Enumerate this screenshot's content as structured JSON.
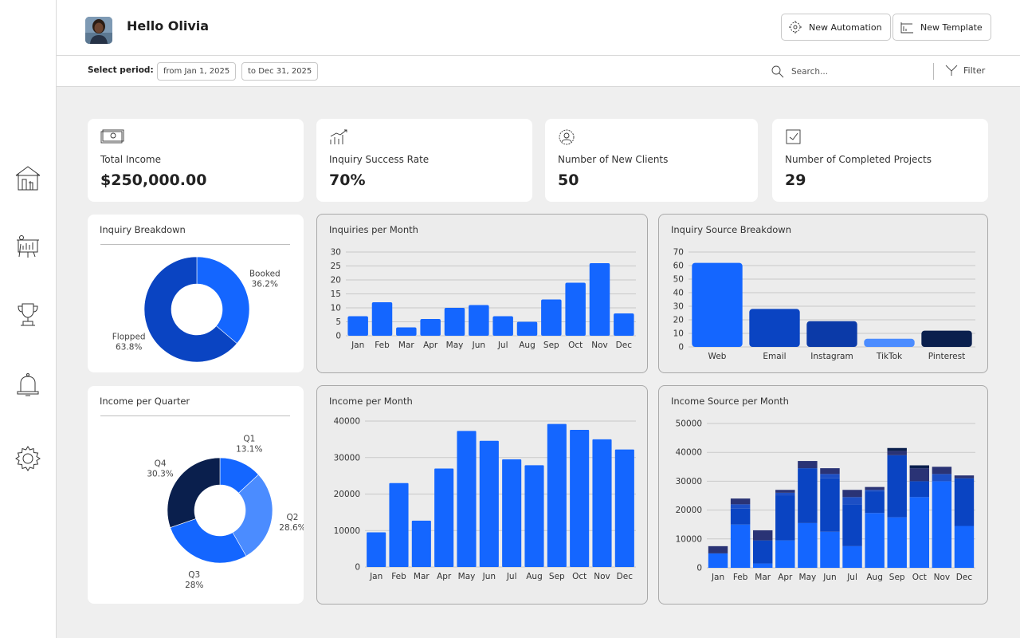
{
  "user": {
    "greeting": "Hello Olivia"
  },
  "header": {
    "new_automation_label": "New Automation",
    "new_template_label": "New Template"
  },
  "period": {
    "label": "Select period:",
    "from": "from Jan 1, 2025",
    "to": "to Dec 31, 2025"
  },
  "search": {
    "placeholder": "Search..."
  },
  "filter": {
    "label": "Filter"
  },
  "sidebar": {
    "items": [
      "home-icon",
      "presentation-icon",
      "trophy-icon",
      "bell-icon",
      "gear-icon"
    ]
  },
  "stats": [
    {
      "label": "Total Income",
      "value": "$250,000.00",
      "icon": "cash-icon"
    },
    {
      "label": "Inquiry Success Rate",
      "value": "70%",
      "icon": "growth-chart-icon"
    },
    {
      "label": "Number of New Clients",
      "value": "50",
      "icon": "clients-icon"
    },
    {
      "label": "Number of Completed Projects",
      "value": "29",
      "icon": "completed-projects-icon"
    }
  ],
  "colors": {
    "primary": "#1466ff",
    "blue2": "#0a44c2",
    "blue3": "#0b3aa8",
    "light_blue": "#4b8cff",
    "navy": "#0a1f4d",
    "purple_navy": "#2a3375"
  },
  "chart_data": [
    {
      "type": "pie",
      "title": "Inquiry Breakdown",
      "donut": true,
      "slices": [
        {
          "label": "Booked",
          "value": 36.2,
          "display": "36.2%",
          "color": "#1466ff"
        },
        {
          "label": "Flopped",
          "value": 63.8,
          "display": "63.8%",
          "color": "#0a44c2"
        }
      ]
    },
    {
      "type": "bar",
      "title": "Inquiries per Month",
      "categories": [
        "Jan",
        "Feb",
        "Mar",
        "Apr",
        "May",
        "Jun",
        "Jul",
        "Aug",
        "Sep",
        "Oct",
        "Nov",
        "Dec"
      ],
      "values": [
        7,
        12,
        3,
        6,
        10,
        11,
        7,
        5,
        13,
        19,
        26,
        8
      ],
      "ylim": [
        0,
        30
      ],
      "yticks": [
        0,
        5,
        10,
        15,
        20,
        25,
        30
      ],
      "grid": true,
      "color": "#1466ff"
    },
    {
      "type": "bar",
      "title": "Inquiry Source Breakdown",
      "categories": [
        "Web",
        "Email",
        "Instagram",
        "TikTok",
        "Pinterest"
      ],
      "values": [
        62,
        28,
        19,
        6,
        12
      ],
      "colors": [
        "#1466ff",
        "#0a44c2",
        "#0b3aa8",
        "#4b8cff",
        "#0a1f4d"
      ],
      "ylim": [
        0,
        70
      ],
      "yticks": [
        0,
        10,
        20,
        30,
        40,
        50,
        60,
        70
      ],
      "grid": true
    },
    {
      "type": "pie",
      "title": "Income per Quarter",
      "donut": true,
      "slices": [
        {
          "label": "Q1",
          "value": 13.1,
          "display": "13.1%",
          "color": "#1466ff"
        },
        {
          "label": "Q2",
          "value": 28.6,
          "display": "28.6%",
          "color": "#4b8cff"
        },
        {
          "label": "Q3",
          "value": 28.0,
          "display": "28%",
          "color": "#1466ff"
        },
        {
          "label": "Q4",
          "value": 30.3,
          "display": "30.3%",
          "color": "#0a1f4d"
        }
      ]
    },
    {
      "type": "bar",
      "title": "Income per Month",
      "categories": [
        "Jan",
        "Feb",
        "Mar",
        "Apr",
        "May",
        "Jun",
        "Jul",
        "Aug",
        "Sep",
        "Oct",
        "Nov",
        "Dec"
      ],
      "values": [
        9500,
        23000,
        12700,
        27000,
        37300,
        34600,
        29500,
        27900,
        39200,
        37600,
        35000,
        32200
      ],
      "ylim": [
        0,
        40000
      ],
      "yticks": [
        0,
        10000,
        20000,
        30000,
        40000
      ],
      "grid": true,
      "color": "#1466ff"
    },
    {
      "type": "bar",
      "stacked": true,
      "title": "Income Source per Month",
      "categories": [
        "Jan",
        "Feb",
        "Mar",
        "Apr",
        "May",
        "Jun",
        "Jul",
        "Aug",
        "Sep",
        "Oct",
        "Nov",
        "Dec"
      ],
      "ylim": [
        0,
        50000
      ],
      "yticks": [
        0,
        10000,
        20000,
        30000,
        40000,
        50000
      ],
      "grid": true,
      "series": [
        {
          "values": [
            5000,
            15000,
            1500,
            9500,
            15500,
            12500,
            7500,
            19000,
            17500,
            24500,
            30000,
            14500
          ],
          "color": "#1466ff"
        },
        {
          "values": [
            0,
            5500,
            8000,
            15500,
            19000,
            18500,
            14500,
            7500,
            21500,
            5500,
            0,
            16500
          ],
          "color": "#0a44c2"
        },
        {
          "values": [
            0,
            1500,
            0,
            1000,
            0,
            1500,
            2500,
            500,
            0,
            0,
            2500,
            0
          ],
          "color": "#1d4fc4"
        },
        {
          "values": [
            2500,
            2000,
            3500,
            1000,
            2500,
            2000,
            2500,
            1000,
            1500,
            4500,
            2500,
            1000
          ],
          "color": "#2a3375"
        },
        {
          "values": [
            0,
            0,
            0,
            0,
            0,
            0,
            0,
            0,
            1000,
            1000,
            0,
            0
          ],
          "color": "#0a1f4d"
        }
      ]
    }
  ]
}
